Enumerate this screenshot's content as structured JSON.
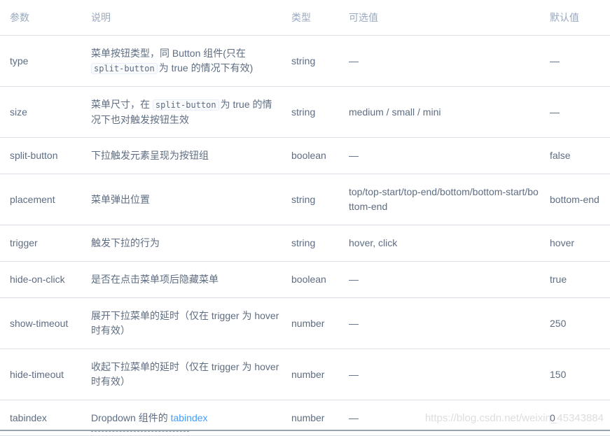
{
  "headers": [
    "参数",
    "说明",
    "类型",
    "可选值",
    "默认值"
  ],
  "rows": [
    {
      "param": "type",
      "desc_pre": "菜单按钮类型，同 Button 组件(只在",
      "desc_code": "split-button",
      "desc_post": "为 true 的情况下有效)",
      "type": "string",
      "options": "—",
      "default": "—"
    },
    {
      "param": "size",
      "desc_pre": "菜单尺寸，在",
      "desc_code": "split-button",
      "desc_post": "为 true 的情况下也对触发按钮生效",
      "type": "string",
      "options": "medium / small / mini",
      "default": "—"
    },
    {
      "param": "split-button",
      "desc": "下拉触发元素呈现为按钮组",
      "type": "boolean",
      "options": "—",
      "default": "false"
    },
    {
      "param": "placement",
      "desc": "菜单弹出位置",
      "type": "string",
      "options": "top/top-start/top-end/bottom/bottom-start/bottom-end",
      "default": "bottom-end"
    },
    {
      "param": "trigger",
      "desc": "触发下拉的行为",
      "type": "string",
      "options": "hover, click",
      "default": "hover"
    },
    {
      "param": "hide-on-click",
      "desc": "是否在点击菜单项后隐藏菜单",
      "type": "boolean",
      "options": "—",
      "default": "true"
    },
    {
      "param": "show-timeout",
      "desc": "展开下拉菜单的延时（仅在 trigger 为 hover 时有效）",
      "type": "number",
      "options": "—",
      "default": "250"
    },
    {
      "param": "hide-timeout",
      "desc": "收起下拉菜单的延时（仅在 trigger 为 hover 时有效）",
      "type": "number",
      "options": "—",
      "default": "150"
    },
    {
      "param": "tabindex",
      "desc_pre": "Dropdown 组件的",
      "desc_link": "tabindex",
      "type": "number",
      "options": "—",
      "default": "0"
    }
  ],
  "watermark": "https://blog.csdn.net/weixin_45343884",
  "colors": {
    "text": "#5e6d82",
    "header": "#99a9bf",
    "border": "#dcdfe6",
    "link": "#409eff"
  }
}
